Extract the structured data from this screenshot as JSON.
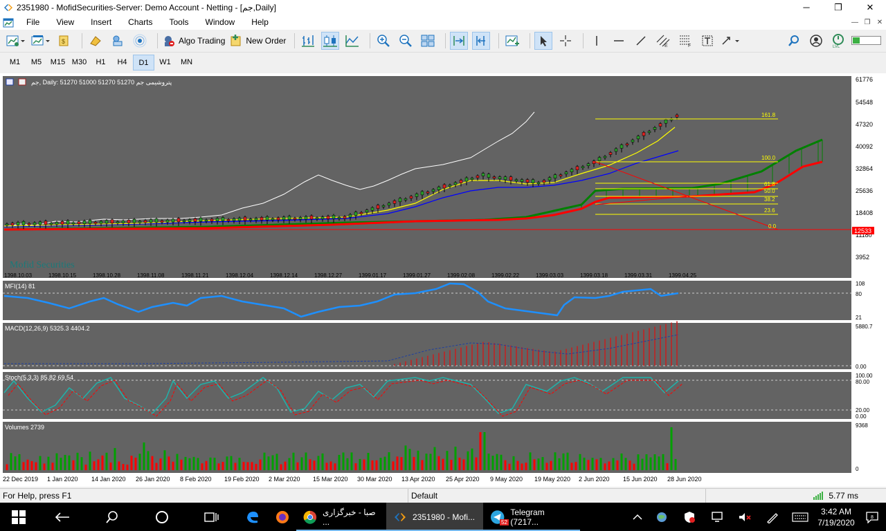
{
  "window": {
    "title": "2351980 - MofidSecurities-Server: Demo Account - Netting - [جم,Daily]",
    "minimize": "─",
    "maximize": "❐",
    "close": "✕"
  },
  "menu": {
    "items": [
      "File",
      "View",
      "Insert",
      "Charts",
      "Tools",
      "Window",
      "Help"
    ]
  },
  "toolbar": {
    "algo_trading": "Algo Trading",
    "new_order": "New Order"
  },
  "timeframes": {
    "items": [
      "M1",
      "M5",
      "M15",
      "M30",
      "H1",
      "H4",
      "D1",
      "W1",
      "MN"
    ],
    "active": "D1"
  },
  "main_chart": {
    "header": "جم, Daily:  51270 51000 51270 51270   پتروشیمی جم",
    "watermark": "Mofid Securities",
    "price_labels": [
      "61776",
      "54548",
      "47320",
      "40092",
      "32864",
      "25636",
      "18408",
      "11180",
      "3952"
    ],
    "current_price": "12533",
    "date_labels": [
      "1398.10.03",
      "1398.10.15",
      "1398.10.28",
      "1398.11.08",
      "1398.11.21",
      "1398.12.04",
      "1398.12.14",
      "1398.12.27",
      "1399.01.17",
      "1399.01.27",
      "1399.02.08",
      "1399.02.22",
      "1399.03.03",
      "1399.03.18",
      "1399.03.31",
      "1399.04.25"
    ],
    "fib_levels": [
      "161.8",
      "100.0",
      "61.8",
      "50.0",
      "38.2",
      "23.6",
      "0.0"
    ]
  },
  "mfi": {
    "header": "MFI(14) 81",
    "scale": [
      "108",
      "80",
      "21"
    ]
  },
  "macd": {
    "header": "MACD(12,26,9) 5325.3 4404.2",
    "scale": [
      "5880.7",
      "0.00"
    ]
  },
  "stoch": {
    "header": "Stoch(5,3,3) 85.82 69.54",
    "scale": [
      "100.00",
      "80.00",
      "20.00",
      "0.00"
    ]
  },
  "volumes": {
    "header": "Volumes 2739",
    "scale": [
      "9368",
      "0"
    ]
  },
  "bottom_dates": [
    "22 Dec 2019",
    "1 Jan 2020",
    "14 Jan 2020",
    "26 Jan 2020",
    "8 Feb 2020",
    "19 Feb 2020",
    "2 Mar 2020",
    "15 Mar 2020",
    "30 Mar 2020",
    "13 Apr 2020",
    "25 Apr 2020",
    "9 May 2020",
    "19 May 2020",
    "2 Jun 2020",
    "15 Jun 2020",
    "28 Jun 2020"
  ],
  "status": {
    "help": "For Help, press F1",
    "profile": "Default",
    "ping": "5.77 ms"
  },
  "taskbar": {
    "apps": [
      {
        "label": "صبا - خبرگزاری ..."
      },
      {
        "label": "2351980 - Mofi..."
      },
      {
        "label": "Telegram (7217..."
      }
    ],
    "telegram_badge": "52",
    "time": "3:42 AM",
    "date": "7/19/2020"
  },
  "colors": {
    "chart_bg": "#636363",
    "fib": "#ffff00",
    "white_line": "#ffffff",
    "ma_yellow": "#ffff00",
    "ma_blue": "#0000ff",
    "ma_red": "#ff0000",
    "ma_green": "#008000",
    "mfi": "#1e90ff",
    "stoch_main": "#20b2aa",
    "stoch_signal": "#ff0000",
    "vol_up": "#00a000",
    "vol_down": "#ff0000"
  }
}
